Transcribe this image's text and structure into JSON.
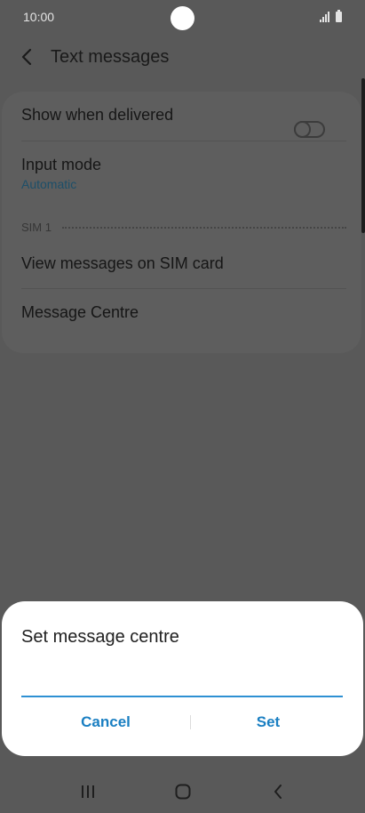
{
  "status_bar": {
    "time": "10:00",
    "icons": [
      "signal-icon",
      "battery-icon"
    ]
  },
  "header": {
    "back_icon": "chevron-left-icon",
    "title": "Text messages"
  },
  "settings": {
    "show_when_delivered": {
      "label": "Show when delivered",
      "enabled": false
    },
    "input_mode": {
      "label": "Input mode",
      "value": "Automatic"
    },
    "sim_section": {
      "label": "SIM 1"
    },
    "view_messages": {
      "label": "View messages on SIM card"
    },
    "message_centre": {
      "label": "Message Centre"
    }
  },
  "dialog": {
    "title": "Set message centre",
    "input_value": "",
    "cancel_label": "Cancel",
    "set_label": "Set"
  },
  "nav_bar": {
    "icons": [
      "recents-icon",
      "home-icon",
      "back-icon"
    ]
  },
  "colors": {
    "scrim_background": "#595959",
    "accent": "#1a7fc2",
    "input_underline": "#2e90d3",
    "dialog_background": "#ffffff"
  }
}
